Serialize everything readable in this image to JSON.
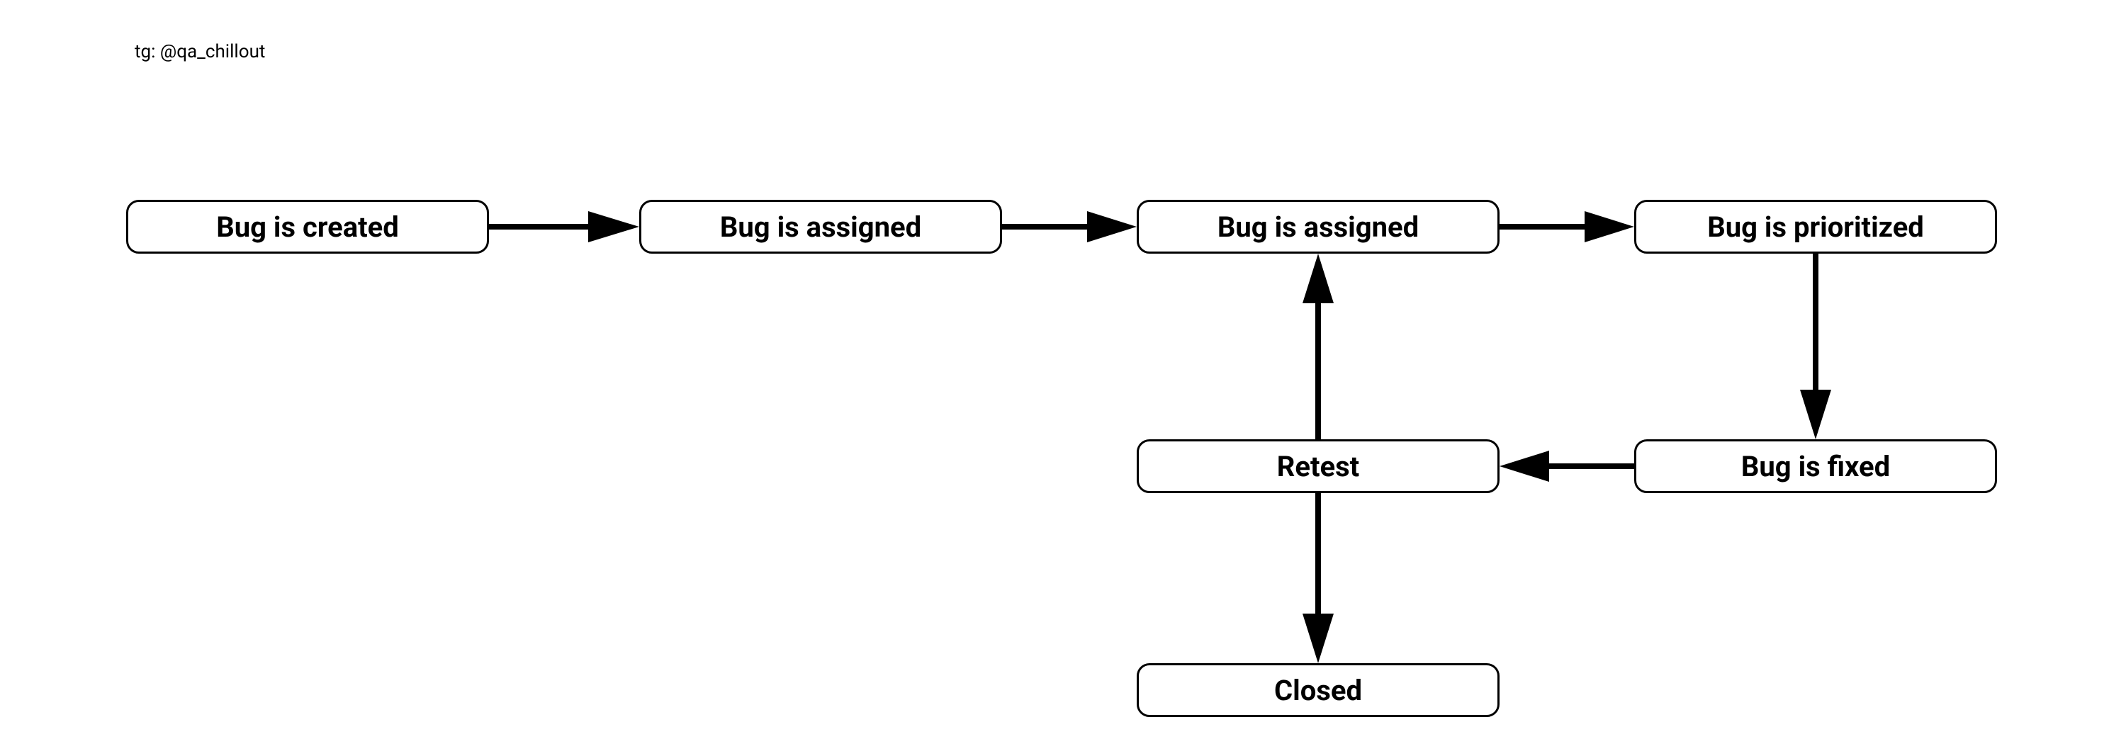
{
  "attribution": "tg: @qa_chillout",
  "nodes": {
    "created": "Bug is created",
    "assigned1": "Bug is assigned",
    "assigned2": "Bug is assigned",
    "prioritized": "Bug is prioritized",
    "fixed": "Bug is fixed",
    "retest": "Retest",
    "closed": "Closed"
  }
}
